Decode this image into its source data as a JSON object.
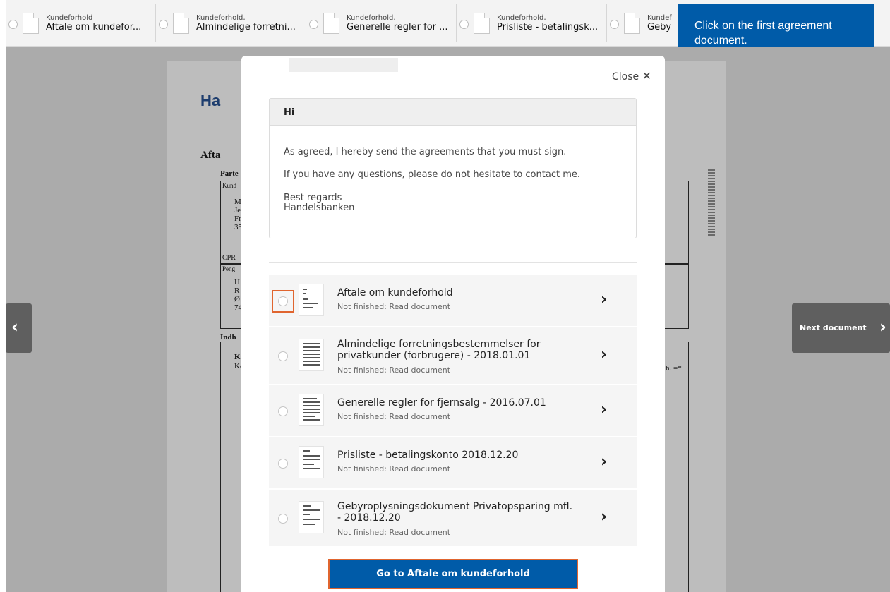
{
  "tabs": [
    {
      "category": "Kundeforhold",
      "title": "Aftale om kundefor..."
    },
    {
      "category": "Kundeforhold,",
      "title": "Almindelige forretni..."
    },
    {
      "category": "Kundeforhold,",
      "title": "Generelle regler for ..."
    },
    {
      "category": "Kundeforhold,",
      "title": "Prisliste - betalingsk..."
    },
    {
      "category": "Kundef",
      "title": "Geby"
    }
  ],
  "tooltip": {
    "text": "Click on the first agreement document."
  },
  "background_document": {
    "heading": "Ha",
    "subheading": "Afta",
    "fragments": [
      "Parte",
      "Kund",
      "M",
      "Je",
      "Fr",
      "35",
      "CPR-",
      "Peng",
      "H",
      "R",
      "Ø",
      "74",
      "Indh",
      "K",
      "Ke",
      "h. =*"
    ]
  },
  "navigation": {
    "next_label": "Next document"
  },
  "modal": {
    "close_label": "Close",
    "greeting": "Hi",
    "message_lines": [
      "As agreed, I hereby send the agreements that you must sign.",
      "If you have any questions, please do not hesitate to contact me."
    ],
    "signoff": "Best regards",
    "sender": "Handelsbanken",
    "documents": [
      {
        "title": "Aftale om kundeforhold",
        "status": "Not finished: Read document",
        "thumb_icon": "document-thumbnail-icon"
      },
      {
        "title": "Almindelige forretningsbestemmelser for privatkunder (forbrugere) - 2018.01.01",
        "status": "Not finished: Read document",
        "thumb_icon": "document-thumbnail-icon"
      },
      {
        "title": "Generelle regler for fjernsalg - 2016.07.01",
        "status": "Not finished: Read document",
        "thumb_icon": "document-thumbnail-icon"
      },
      {
        "title": "Prisliste - betalingskonto 2018.12.20",
        "status": "Not finished: Read document",
        "thumb_icon": "document-thumbnail-icon"
      },
      {
        "title": "Gebyroplysningsdokument Privatopsparing mfl. - 2018.12.20",
        "status": "Not finished: Read document",
        "thumb_icon": "document-thumbnail-icon"
      }
    ],
    "primary_button": "Go to Aftale om kundeforhold"
  },
  "colors": {
    "brand_blue": "#005ba8",
    "highlight_orange": "#e0652f",
    "overlay_gray": "#ababab"
  }
}
